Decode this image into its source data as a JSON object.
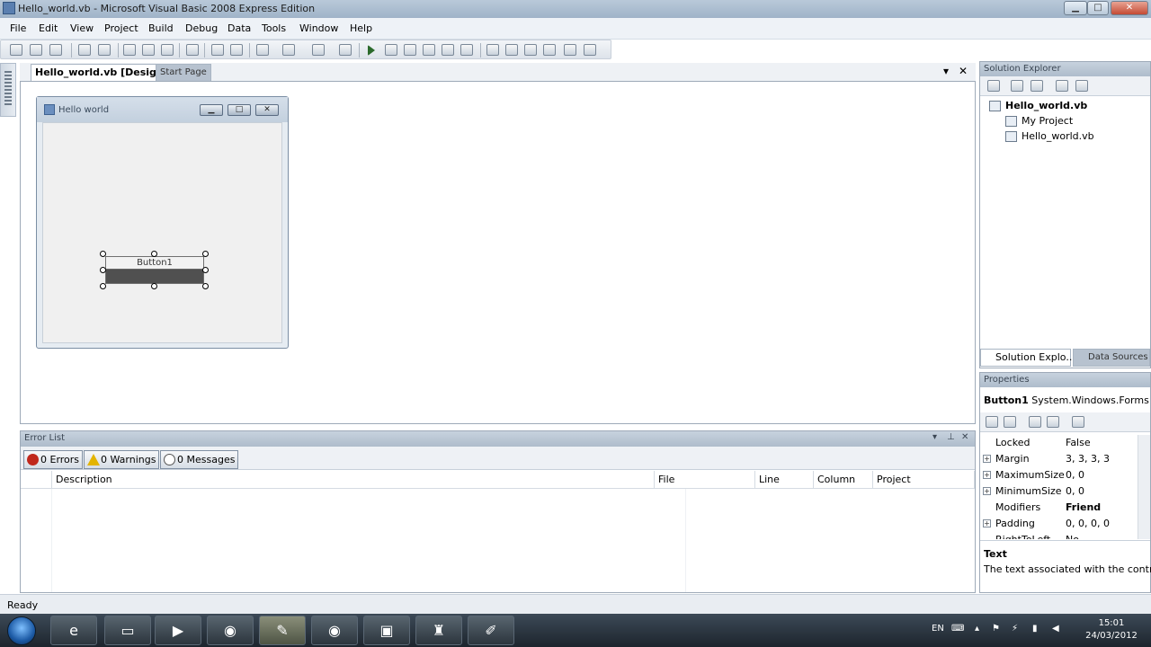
{
  "window": {
    "title": "Hello_world.vb - Microsoft Visual Basic 2008 Express Edition",
    "min_glyph": "▁",
    "max_glyph": "□",
    "close_glyph": "✕"
  },
  "menu": [
    "File",
    "Edit",
    "View",
    "Project",
    "Build",
    "Debug",
    "Data",
    "Tools",
    "Window",
    "Help"
  ],
  "doc_tabs": {
    "active": "Hello_world.vb [Design]*",
    "inactive": "Start Page",
    "dropdown_glyph": "▾",
    "close_glyph": "✕"
  },
  "form": {
    "title": "Hello world",
    "button_text": "Button1"
  },
  "error_list": {
    "title": "Error List",
    "errors": "0 Errors",
    "warnings": "0 Warnings",
    "messages": "0 Messages",
    "columns": [
      "",
      "Description",
      "File",
      "Line",
      "Column",
      "Project"
    ]
  },
  "solution_explorer": {
    "title": "Solution Explorer",
    "root": "Hello_world.vb",
    "items": [
      "My Project",
      "Hello_world.vb"
    ],
    "tabs": [
      "Solution Explo...",
      "Data Sources"
    ]
  },
  "properties": {
    "title": "Properties",
    "object": "Button1",
    "object_type": "System.Windows.Forms.I",
    "rows": [
      {
        "name": "Locked",
        "value": "False",
        "expandable": false,
        "bold": false
      },
      {
        "name": "Margin",
        "value": "3, 3, 3, 3",
        "expandable": true,
        "bold": false
      },
      {
        "name": "MaximumSize",
        "value": "0, 0",
        "expandable": true,
        "bold": false
      },
      {
        "name": "MinimumSize",
        "value": "0, 0",
        "expandable": true,
        "bold": false
      },
      {
        "name": "Modifiers",
        "value": "Friend",
        "expandable": false,
        "bold": true
      },
      {
        "name": "Padding",
        "value": "0, 0, 0, 0",
        "expandable": true,
        "bold": false
      },
      {
        "name": "RightToLeft",
        "value": "No",
        "expandable": false,
        "bold": false
      }
    ],
    "description_title": "Text",
    "description": "The text associated with the control."
  },
  "status": "Ready",
  "taskbar": {
    "language": "EN",
    "time": "15:01",
    "date": "24/03/2012"
  }
}
